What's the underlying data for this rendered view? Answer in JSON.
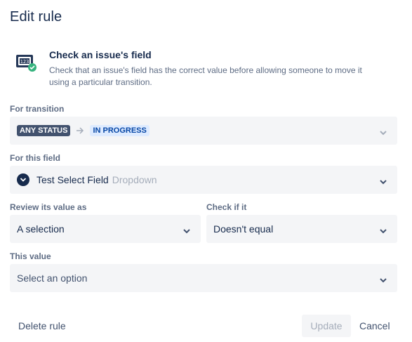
{
  "dialog": {
    "title": "Edit rule"
  },
  "rule": {
    "heading": "Check an issue's field",
    "description": "Check that an issue's field has the correct value before allowing someone to move it using a particular transition."
  },
  "transition": {
    "label": "For transition",
    "from_status": "ANY STATUS",
    "to_status": "IN PROGRESS"
  },
  "field": {
    "label": "For this field",
    "value": "Test Select Field",
    "type": "Dropdown"
  },
  "review": {
    "label": "Review its value as",
    "value": "A selection"
  },
  "check": {
    "label": "Check if it",
    "value": "Doesn't equal"
  },
  "this_value": {
    "label": "This value",
    "placeholder": "Select an option"
  },
  "footer": {
    "delete_label": "Delete rule",
    "update_label": "Update",
    "cancel_label": "Cancel"
  },
  "colors": {
    "text": "#172b4d",
    "subtle": "#5e6c84",
    "field_bg": "#f4f5f7",
    "check_green": "#36b37e",
    "status_blue_bg": "#deebff",
    "status_blue_text": "#0747a6"
  },
  "icons": {
    "rule_icon": "field-check-icon",
    "chevron": "chevron-down-icon",
    "arrow": "arrow-right-icon"
  }
}
